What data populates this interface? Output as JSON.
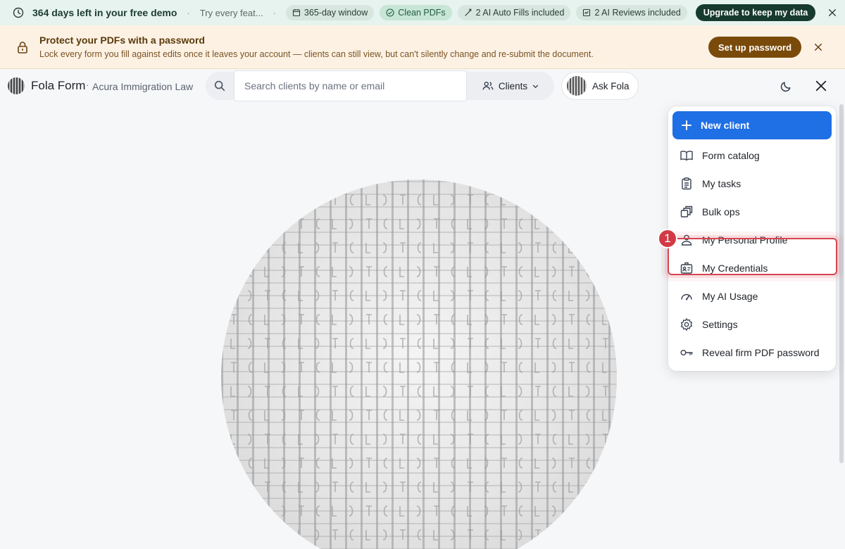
{
  "trial": {
    "title": "364 days left in your free demo",
    "try_text": "Try every feat...",
    "chips": [
      "365-day window",
      "Clean PDFs",
      "2 AI Auto Fills included",
      "2 AI Reviews included"
    ],
    "upgrade_label": "Upgrade to keep my data"
  },
  "password_banner": {
    "title": "Protect your PDFs with a password",
    "body": "Lock every form you fill against edits once it leaves your account — clients can still view, but can't silently change and re-submit the document.",
    "button_label": "Set up password"
  },
  "header": {
    "brand": "Fola Form",
    "separator": "·",
    "firm": "Acura Immigration Law",
    "search_placeholder": "Search clients by name or email",
    "scope_label": "Clients",
    "ask_label": "Ask Fola"
  },
  "menu": {
    "new_client": "New client",
    "items": [
      {
        "label": "Form catalog",
        "icon": "book-icon"
      },
      {
        "label": "My tasks",
        "icon": "clipboard-icon"
      },
      {
        "label": "Bulk ops",
        "icon": "stack-icon"
      },
      {
        "label": "My Personal Profile",
        "icon": "person-icon"
      },
      {
        "label": "My Credentials",
        "icon": "id-badge-icon"
      },
      {
        "label": "My AI Usage",
        "icon": "gauge-icon"
      },
      {
        "label": "Settings",
        "icon": "gear-icon"
      },
      {
        "label": "Reveal firm PDF password",
        "icon": "key-icon"
      }
    ]
  },
  "annotation": {
    "badge": "1"
  },
  "colors": {
    "accent": "#1f6fe5",
    "upgrade": "#173a2e",
    "banner_button": "#7a4a0a",
    "highlight": "#d64550"
  }
}
